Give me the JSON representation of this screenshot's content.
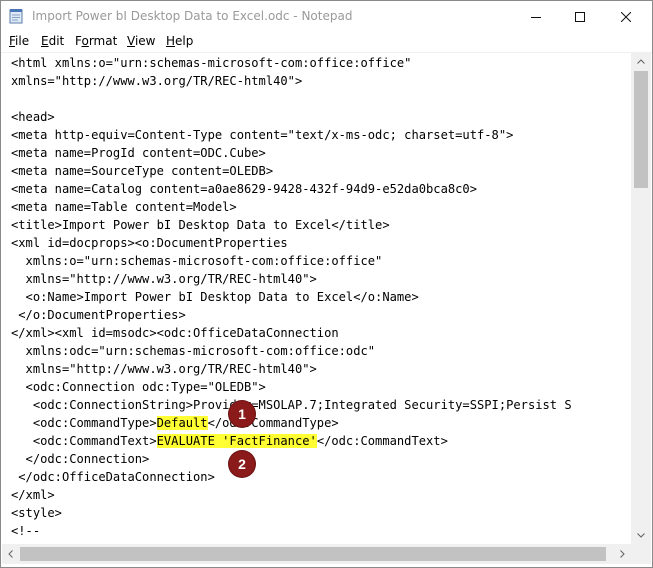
{
  "window": {
    "title": "Import Power bI Desktop Data to Excel.odc - Notepad"
  },
  "menu": [
    {
      "label": "File",
      "accel": "F",
      "rest": "ile"
    },
    {
      "label": "Edit",
      "accel": "E",
      "rest": "dit"
    },
    {
      "label": "Format",
      "accel": "o",
      "pre": "F",
      "rest": "rmat"
    },
    {
      "label": "View",
      "accel": "V",
      "rest": "iew"
    },
    {
      "label": "Help",
      "accel": "H",
      "rest": "elp"
    }
  ],
  "editor": {
    "lines": [
      "<html xmlns:o=\"urn:schemas-microsoft-com:office:office\"",
      "xmlns=\"http://www.w3.org/TR/REC-html40\">",
      "",
      "<head>",
      "<meta http-equiv=Content-Type content=\"text/x-ms-odc; charset=utf-8\">",
      "<meta name=ProgId content=ODC.Cube>",
      "<meta name=SourceType content=OLEDB>",
      "<meta name=Catalog content=a0ae8629-9428-432f-94d9-e52da0bca8c0>",
      "<meta name=Table content=Model>",
      "<title>Import Power bI Desktop Data to Excel</title>",
      "<xml id=docprops><o:DocumentProperties",
      "  xmlns:o=\"urn:schemas-microsoft-com:office:office\"",
      "  xmlns=\"http://www.w3.org/TR/REC-html40\">",
      "  <o:Name>Import Power bI Desktop Data to Excel</o:Name>",
      " </o:DocumentProperties>",
      "</xml><xml id=msodc><odc:OfficeDataConnection",
      "  xmlns:odc=\"urn:schemas-microsoft-com:office:odc\"",
      "  xmlns=\"http://www.w3.org/TR/REC-html40\">",
      "  <odc:Connection odc:Type=\"OLEDB\">",
      "   <odc:ConnectionString>Provider=MSOLAP.7;Integrated Security=SSPI;Persist S"
    ],
    "line20": {
      "pre": "   <odc:CommandType>",
      "hl": "Default",
      "post": "</odc:CommandType>"
    },
    "line21": {
      "pre": "   <odc:CommandText>",
      "hl": "EVALUATE 'FactFinance'",
      "post": "</odc:CommandText>"
    },
    "lines_tail": [
      "  </odc:Connection>",
      " </odc:OfficeDataConnection>",
      "</xml>",
      "<style>",
      "<!--"
    ]
  },
  "callouts": [
    "1",
    "2"
  ]
}
